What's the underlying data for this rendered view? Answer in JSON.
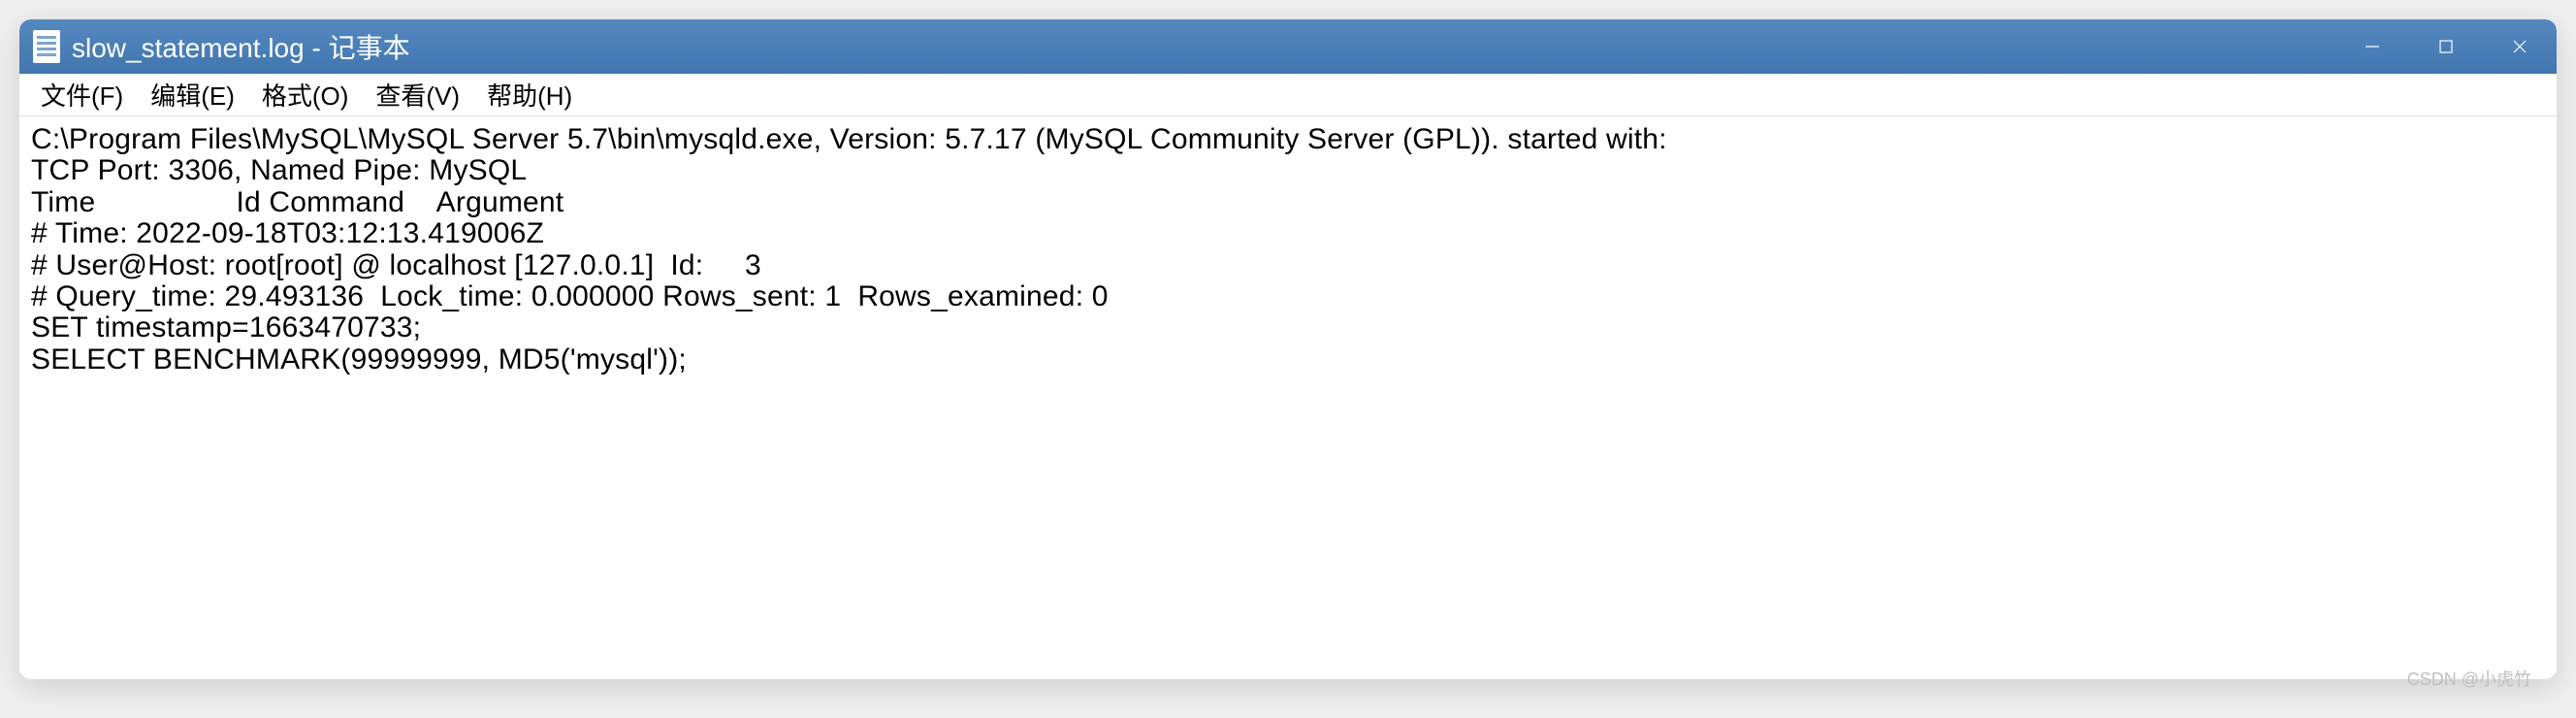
{
  "window": {
    "title": "slow_statement.log - 记事本"
  },
  "menu": {
    "file": "文件(F)",
    "edit": "编辑(E)",
    "format": "格式(O)",
    "view": "查看(V)",
    "help": "帮助(H)"
  },
  "content": {
    "line1": "C:\\Program Files\\MySQL\\MySQL Server 5.7\\bin\\mysqld.exe, Version: 5.7.17 (MySQL Community Server (GPL)). started with:",
    "line2": "TCP Port: 3306, Named Pipe: MySQL",
    "line3": "Time                 Id Command    Argument",
    "line4": "# Time: 2022-09-18T03:12:13.419006Z",
    "line5": "# User@Host: root[root] @ localhost [127.0.0.1]  Id:     3",
    "line6": "# Query_time: 29.493136  Lock_time: 0.000000 Rows_sent: 1  Rows_examined: 0",
    "line7": "SET timestamp=1663470733;",
    "line8": "SELECT BENCHMARK(99999999, MD5('mysql'));"
  },
  "watermark": "CSDN @小虎竹"
}
